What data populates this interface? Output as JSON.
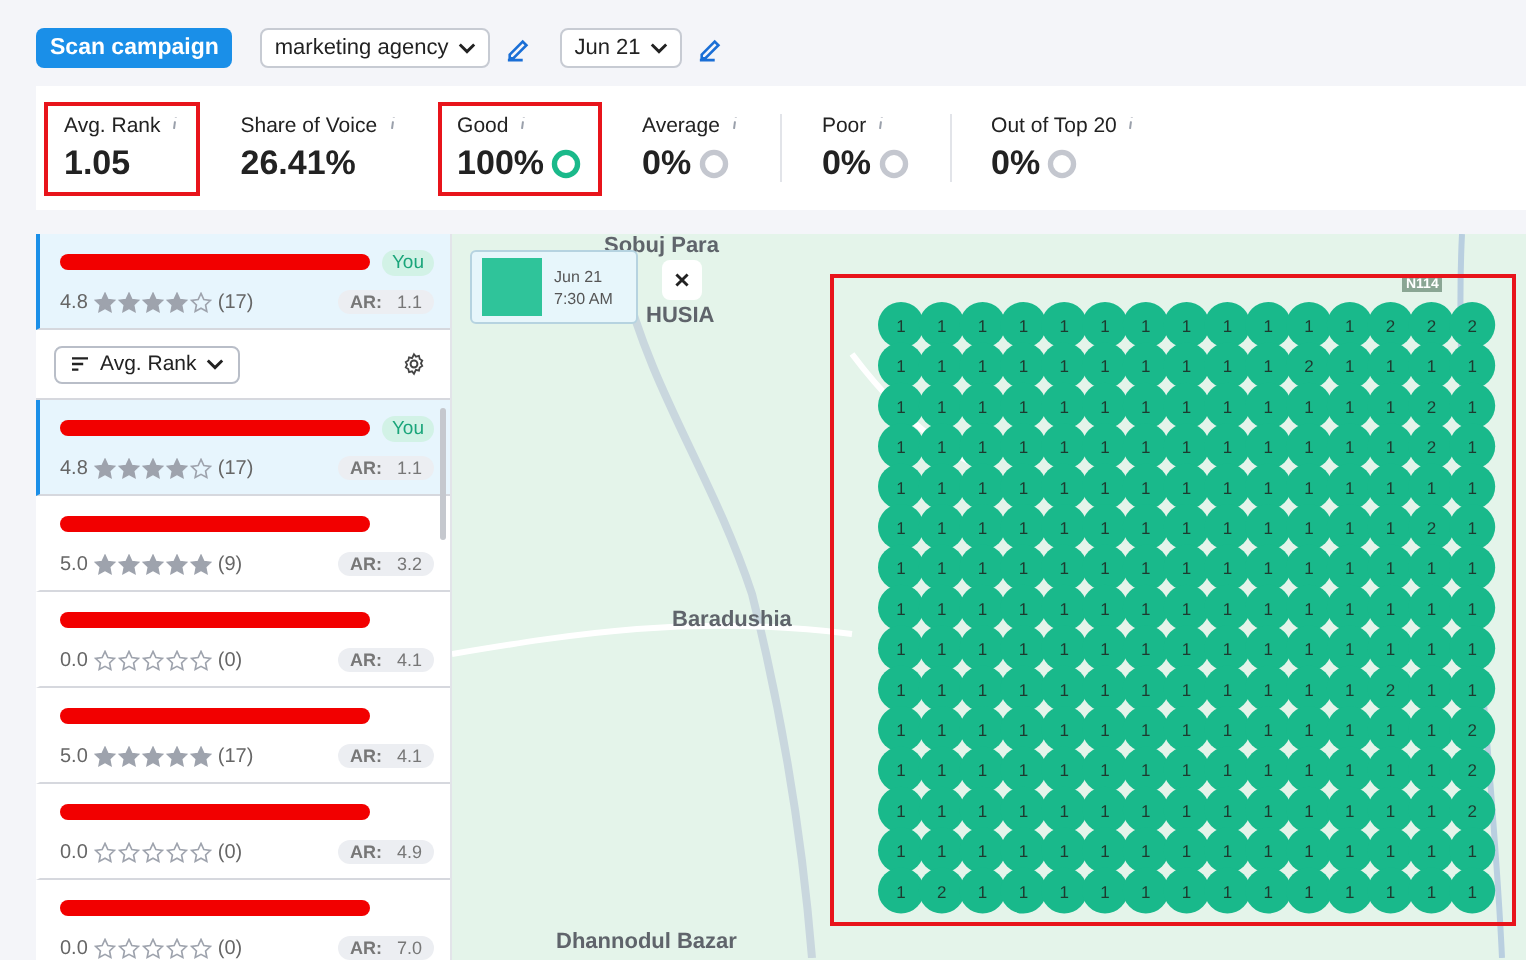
{
  "toolbar": {
    "scan_button": "Scan campaign",
    "keyword": "marketing agency",
    "date": "Jun 21"
  },
  "metrics": [
    {
      "label": "Avg. Rank",
      "value": "1.05",
      "highlighted": true
    },
    {
      "label": "Share of Voice",
      "value": "26.41%",
      "highlighted": false
    },
    {
      "label": "Good",
      "value": "100%",
      "highlighted": true,
      "color": "#1ab98a"
    },
    {
      "label": "Average",
      "value": "0%",
      "highlighted": false,
      "color": "#c4c7cf"
    },
    {
      "label": "Poor",
      "value": "0%",
      "highlighted": false,
      "color": "#c4c7cf"
    },
    {
      "label": "Out of Top 20",
      "value": "0%",
      "highlighted": false,
      "color": "#c4c7cf"
    }
  ],
  "pinned": {
    "badge": "You",
    "rating": "4.8",
    "stars": 4,
    "reviews": "(17)",
    "ar_label": "AR:",
    "ar": "1.1"
  },
  "sort": {
    "label": "Avg. Rank"
  },
  "listings": [
    {
      "badge": "You",
      "rating": "4.8",
      "stars": 4,
      "reviews": "(17)",
      "ar_label": "AR:",
      "ar": "1.1",
      "selected": true
    },
    {
      "rating": "5.0",
      "stars": 5,
      "reviews": "(9)",
      "ar_label": "AR:",
      "ar": "3.2",
      "selected": false
    },
    {
      "rating": "0.0",
      "stars": 0,
      "reviews": "(0)",
      "ar_label": "AR:",
      "ar": "4.1",
      "selected": false
    },
    {
      "rating": "5.0",
      "stars": 5,
      "reviews": "(17)",
      "ar_label": "AR:",
      "ar": "4.1",
      "selected": false
    },
    {
      "rating": "0.0",
      "stars": 0,
      "reviews": "(0)",
      "ar_label": "AR:",
      "ar": "4.9",
      "selected": false
    },
    {
      "rating": "0.0",
      "stars": 0,
      "reviews": "(0)",
      "ar_label": "AR:",
      "ar": "7.0",
      "selected": false
    }
  ],
  "map": {
    "labels": [
      "Sobuj Para",
      "HUSIA",
      "Baradushia",
      "Dhannodul Bazar"
    ],
    "road_sign": "N114",
    "tooltip": {
      "date": "Jun 21",
      "time": "7:30 AM"
    },
    "grid_highlighted": true,
    "grid": [
      [
        "1",
        "1",
        "1",
        "1",
        "1",
        "1",
        "1",
        "1",
        "1",
        "1",
        "1",
        "1",
        "2",
        "2",
        "2"
      ],
      [
        "1",
        "1",
        "1",
        "1",
        "1",
        "1",
        "1",
        "1",
        "1",
        "1",
        "2",
        "1",
        "1",
        "1",
        "1"
      ],
      [
        "1",
        "1",
        "1",
        "1",
        "1",
        "1",
        "1",
        "1",
        "1",
        "1",
        "1",
        "1",
        "1",
        "2",
        "1"
      ],
      [
        "1",
        "1",
        "1",
        "1",
        "1",
        "1",
        "1",
        "1",
        "1",
        "1",
        "1",
        "1",
        "1",
        "2",
        "1"
      ],
      [
        "1",
        "1",
        "1",
        "1",
        "1",
        "1",
        "1",
        "1",
        "1",
        "1",
        "1",
        "1",
        "1",
        "1",
        "1"
      ],
      [
        "1",
        "1",
        "1",
        "1",
        "1",
        "1",
        "1",
        "1",
        "1",
        "1",
        "1",
        "1",
        "1",
        "2",
        "1"
      ],
      [
        "1",
        "1",
        "1",
        "1",
        "1",
        "1",
        "1",
        "1",
        "1",
        "1",
        "1",
        "1",
        "1",
        "1",
        "1"
      ],
      [
        "1",
        "1",
        "1",
        "1",
        "1",
        "1",
        "1",
        "1",
        "1",
        "1",
        "1",
        "1",
        "1",
        "1",
        "1"
      ],
      [
        "1",
        "1",
        "1",
        "1",
        "1",
        "1",
        "1",
        "1",
        "1",
        "1",
        "1",
        "1",
        "1",
        "1",
        "1"
      ],
      [
        "1",
        "1",
        "1",
        "1",
        "1",
        "1",
        "1",
        "1",
        "1",
        "1",
        "1",
        "1",
        "2",
        "1",
        "1"
      ],
      [
        "1",
        "1",
        "1",
        "1",
        "1",
        "1",
        "1",
        "1",
        "1",
        "1",
        "1",
        "1",
        "1",
        "1",
        "2"
      ],
      [
        "1",
        "1",
        "1",
        "1",
        "1",
        "1",
        "1",
        "1",
        "1",
        "1",
        "1",
        "1",
        "1",
        "1",
        "2"
      ],
      [
        "1",
        "1",
        "1",
        "1",
        "1",
        "1",
        "1",
        "1",
        "1",
        "1",
        "1",
        "1",
        "1",
        "1",
        "2"
      ],
      [
        "1",
        "1",
        "1",
        "1",
        "1",
        "1",
        "1",
        "1",
        "1",
        "1",
        "1",
        "1",
        "1",
        "1",
        "1"
      ],
      [
        "1",
        "2",
        "1",
        "1",
        "1",
        "1",
        "1",
        "1",
        "1",
        "1",
        "1",
        "1",
        "1",
        "1",
        "1"
      ]
    ]
  }
}
